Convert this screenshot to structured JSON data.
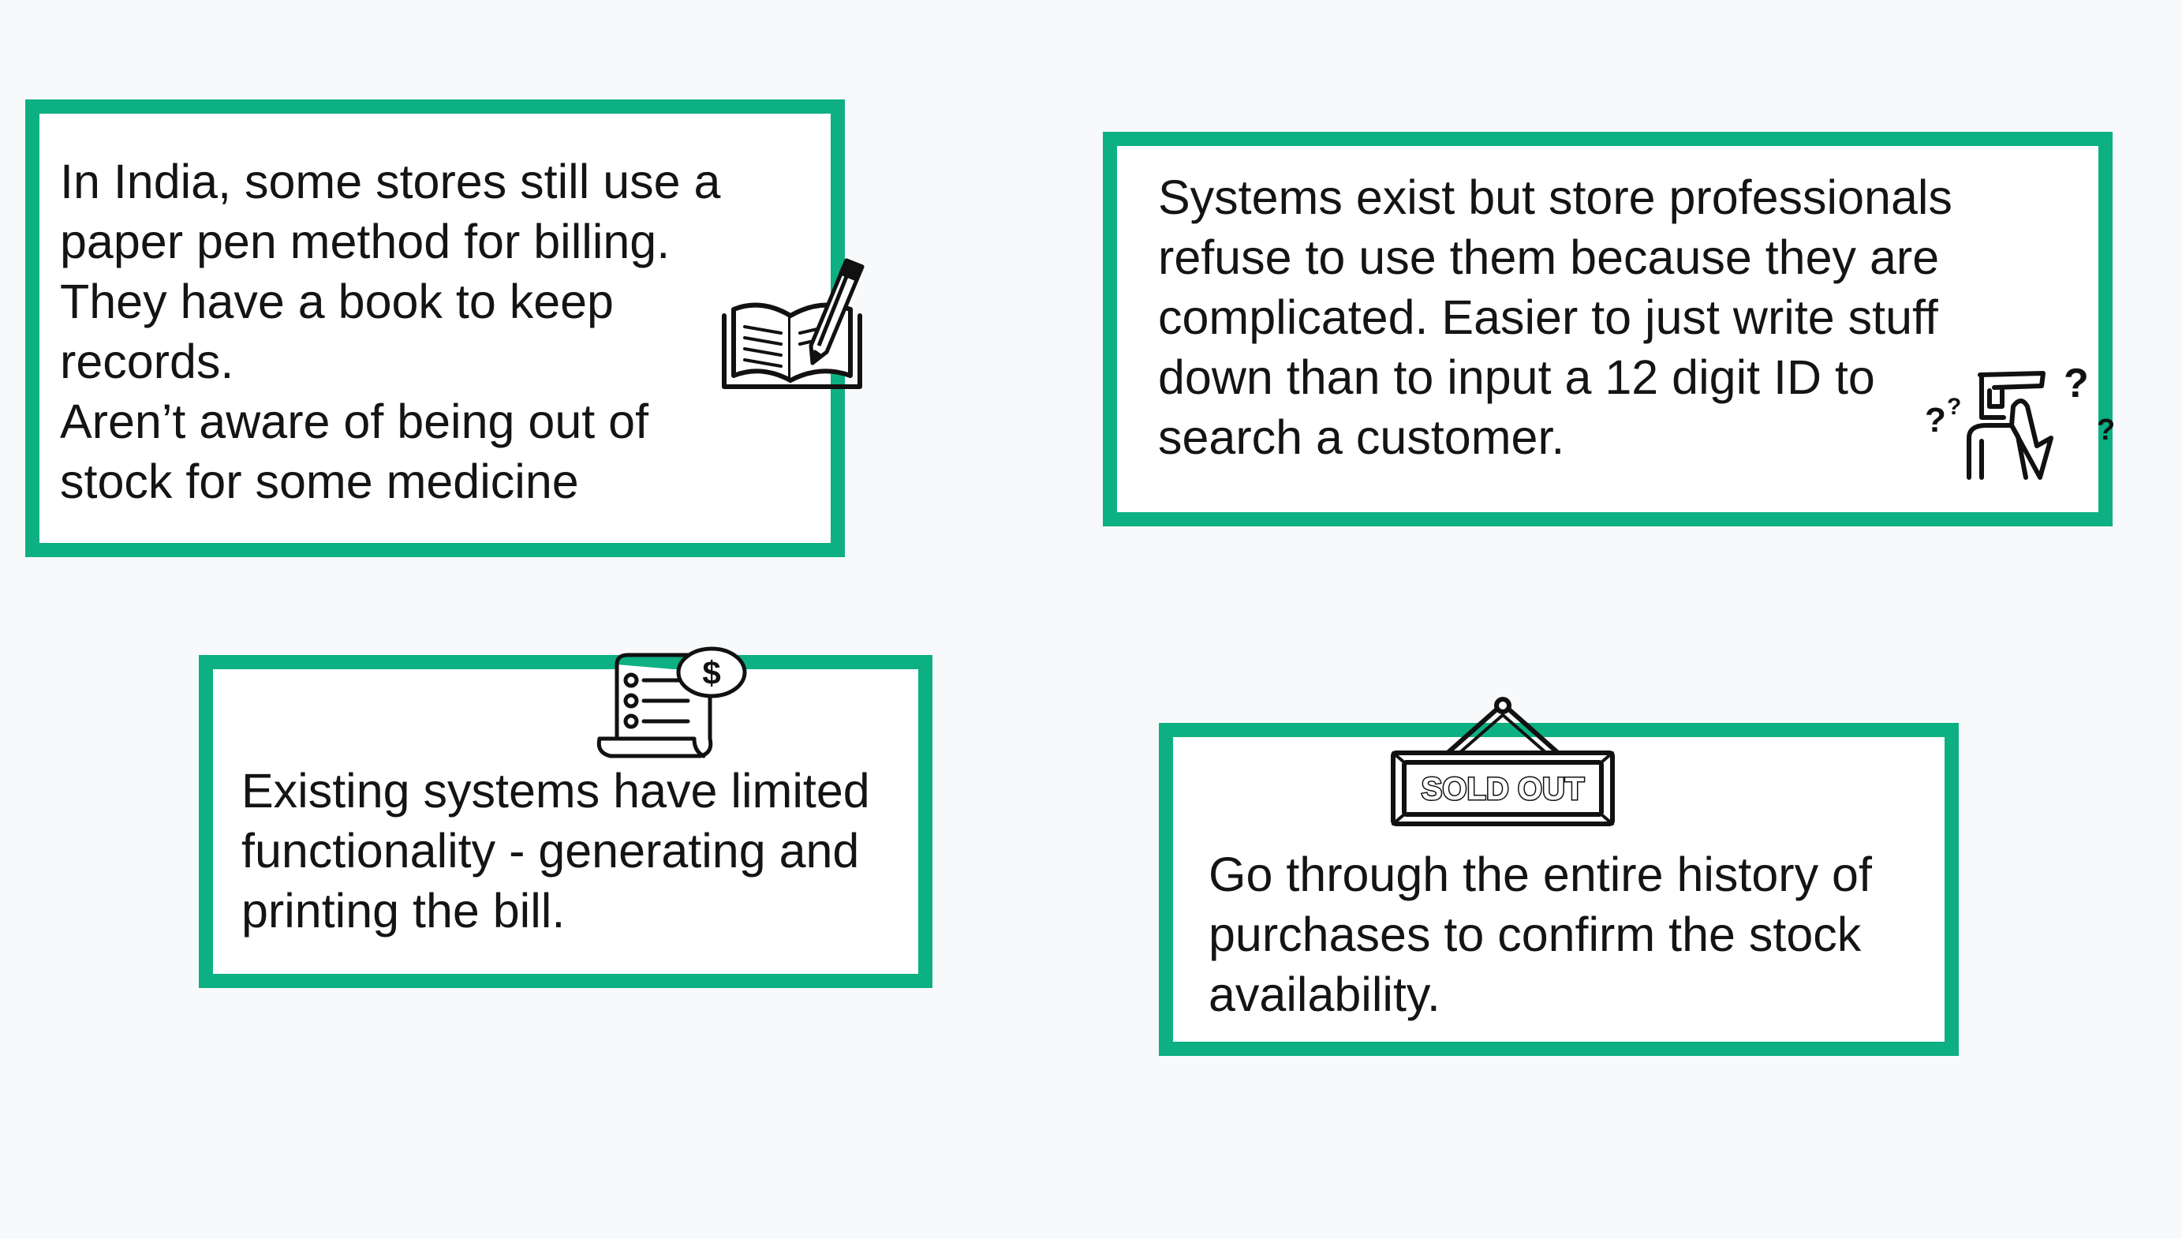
{
  "cards": [
    {
      "lines": [
        "In India, some stores still use a",
        "paper pen method for billing.",
        "They have a book to keep",
        "records.",
        "Aren’t aware of being out of",
        "stock for some medicine"
      ],
      "icon": "book-and-pencil-icon"
    },
    {
      "lines": [
        "Systems exist but store professionals",
        "refuse to use them because they are",
        "complicated. Easier to just write stuff",
        "down than to input a 12 digit ID to",
        "search a customer."
      ],
      "icon": "confused-person-icon"
    },
    {
      "lines": [
        "Existing systems have limited",
        "functionality - generating and",
        "printing the bill."
      ],
      "icon": "receipt-dollar-icon"
    },
    {
      "lines": [
        "Go through the entire history of",
        "purchases to confirm the stock",
        "availability."
      ],
      "icon": "sold-out-sign-icon"
    }
  ],
  "sign_label": "SOLD OUT",
  "receipt_symbol": "$",
  "question_mark": "?",
  "colors": {
    "background": "#f8f9fb",
    "card_border": "#0db083",
    "card_fill": "#ffffff",
    "text": "#141414"
  }
}
